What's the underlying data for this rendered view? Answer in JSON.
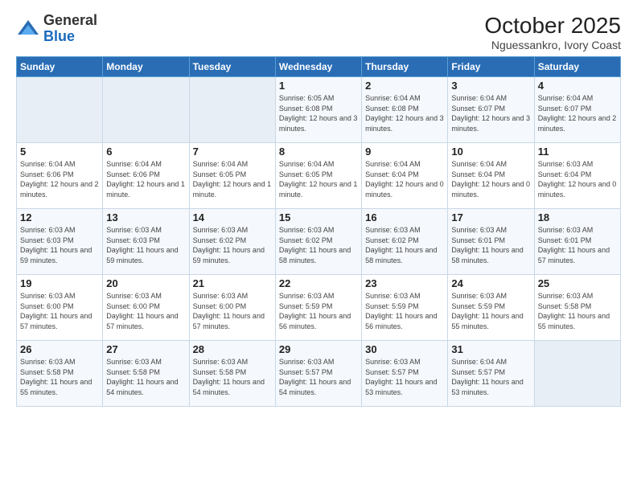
{
  "logo": {
    "text_general": "General",
    "text_blue": "Blue"
  },
  "header": {
    "month_year": "October 2025",
    "location": "Nguessankro, Ivory Coast"
  },
  "weekdays": [
    "Sunday",
    "Monday",
    "Tuesday",
    "Wednesday",
    "Thursday",
    "Friday",
    "Saturday"
  ],
  "weeks": [
    [
      {
        "day": "",
        "info": ""
      },
      {
        "day": "",
        "info": ""
      },
      {
        "day": "",
        "info": ""
      },
      {
        "day": "1",
        "info": "Sunrise: 6:05 AM\nSunset: 6:08 PM\nDaylight: 12 hours and 3 minutes."
      },
      {
        "day": "2",
        "info": "Sunrise: 6:04 AM\nSunset: 6:08 PM\nDaylight: 12 hours and 3 minutes."
      },
      {
        "day": "3",
        "info": "Sunrise: 6:04 AM\nSunset: 6:07 PM\nDaylight: 12 hours and 3 minutes."
      },
      {
        "day": "4",
        "info": "Sunrise: 6:04 AM\nSunset: 6:07 PM\nDaylight: 12 hours and 2 minutes."
      }
    ],
    [
      {
        "day": "5",
        "info": "Sunrise: 6:04 AM\nSunset: 6:06 PM\nDaylight: 12 hours and 2 minutes."
      },
      {
        "day": "6",
        "info": "Sunrise: 6:04 AM\nSunset: 6:06 PM\nDaylight: 12 hours and 1 minute."
      },
      {
        "day": "7",
        "info": "Sunrise: 6:04 AM\nSunset: 6:05 PM\nDaylight: 12 hours and 1 minute."
      },
      {
        "day": "8",
        "info": "Sunrise: 6:04 AM\nSunset: 6:05 PM\nDaylight: 12 hours and 1 minute."
      },
      {
        "day": "9",
        "info": "Sunrise: 6:04 AM\nSunset: 6:04 PM\nDaylight: 12 hours and 0 minutes."
      },
      {
        "day": "10",
        "info": "Sunrise: 6:04 AM\nSunset: 6:04 PM\nDaylight: 12 hours and 0 minutes."
      },
      {
        "day": "11",
        "info": "Sunrise: 6:03 AM\nSunset: 6:04 PM\nDaylight: 12 hours and 0 minutes."
      }
    ],
    [
      {
        "day": "12",
        "info": "Sunrise: 6:03 AM\nSunset: 6:03 PM\nDaylight: 11 hours and 59 minutes."
      },
      {
        "day": "13",
        "info": "Sunrise: 6:03 AM\nSunset: 6:03 PM\nDaylight: 11 hours and 59 minutes."
      },
      {
        "day": "14",
        "info": "Sunrise: 6:03 AM\nSunset: 6:02 PM\nDaylight: 11 hours and 59 minutes."
      },
      {
        "day": "15",
        "info": "Sunrise: 6:03 AM\nSunset: 6:02 PM\nDaylight: 11 hours and 58 minutes."
      },
      {
        "day": "16",
        "info": "Sunrise: 6:03 AM\nSunset: 6:02 PM\nDaylight: 11 hours and 58 minutes."
      },
      {
        "day": "17",
        "info": "Sunrise: 6:03 AM\nSunset: 6:01 PM\nDaylight: 11 hours and 58 minutes."
      },
      {
        "day": "18",
        "info": "Sunrise: 6:03 AM\nSunset: 6:01 PM\nDaylight: 11 hours and 57 minutes."
      }
    ],
    [
      {
        "day": "19",
        "info": "Sunrise: 6:03 AM\nSunset: 6:00 PM\nDaylight: 11 hours and 57 minutes."
      },
      {
        "day": "20",
        "info": "Sunrise: 6:03 AM\nSunset: 6:00 PM\nDaylight: 11 hours and 57 minutes."
      },
      {
        "day": "21",
        "info": "Sunrise: 6:03 AM\nSunset: 6:00 PM\nDaylight: 11 hours and 57 minutes."
      },
      {
        "day": "22",
        "info": "Sunrise: 6:03 AM\nSunset: 5:59 PM\nDaylight: 11 hours and 56 minutes."
      },
      {
        "day": "23",
        "info": "Sunrise: 6:03 AM\nSunset: 5:59 PM\nDaylight: 11 hours and 56 minutes."
      },
      {
        "day": "24",
        "info": "Sunrise: 6:03 AM\nSunset: 5:59 PM\nDaylight: 11 hours and 55 minutes."
      },
      {
        "day": "25",
        "info": "Sunrise: 6:03 AM\nSunset: 5:58 PM\nDaylight: 11 hours and 55 minutes."
      }
    ],
    [
      {
        "day": "26",
        "info": "Sunrise: 6:03 AM\nSunset: 5:58 PM\nDaylight: 11 hours and 55 minutes."
      },
      {
        "day": "27",
        "info": "Sunrise: 6:03 AM\nSunset: 5:58 PM\nDaylight: 11 hours and 54 minutes."
      },
      {
        "day": "28",
        "info": "Sunrise: 6:03 AM\nSunset: 5:58 PM\nDaylight: 11 hours and 54 minutes."
      },
      {
        "day": "29",
        "info": "Sunrise: 6:03 AM\nSunset: 5:57 PM\nDaylight: 11 hours and 54 minutes."
      },
      {
        "day": "30",
        "info": "Sunrise: 6:03 AM\nSunset: 5:57 PM\nDaylight: 11 hours and 53 minutes."
      },
      {
        "day": "31",
        "info": "Sunrise: 6:04 AM\nSunset: 5:57 PM\nDaylight: 11 hours and 53 minutes."
      },
      {
        "day": "",
        "info": ""
      }
    ]
  ]
}
